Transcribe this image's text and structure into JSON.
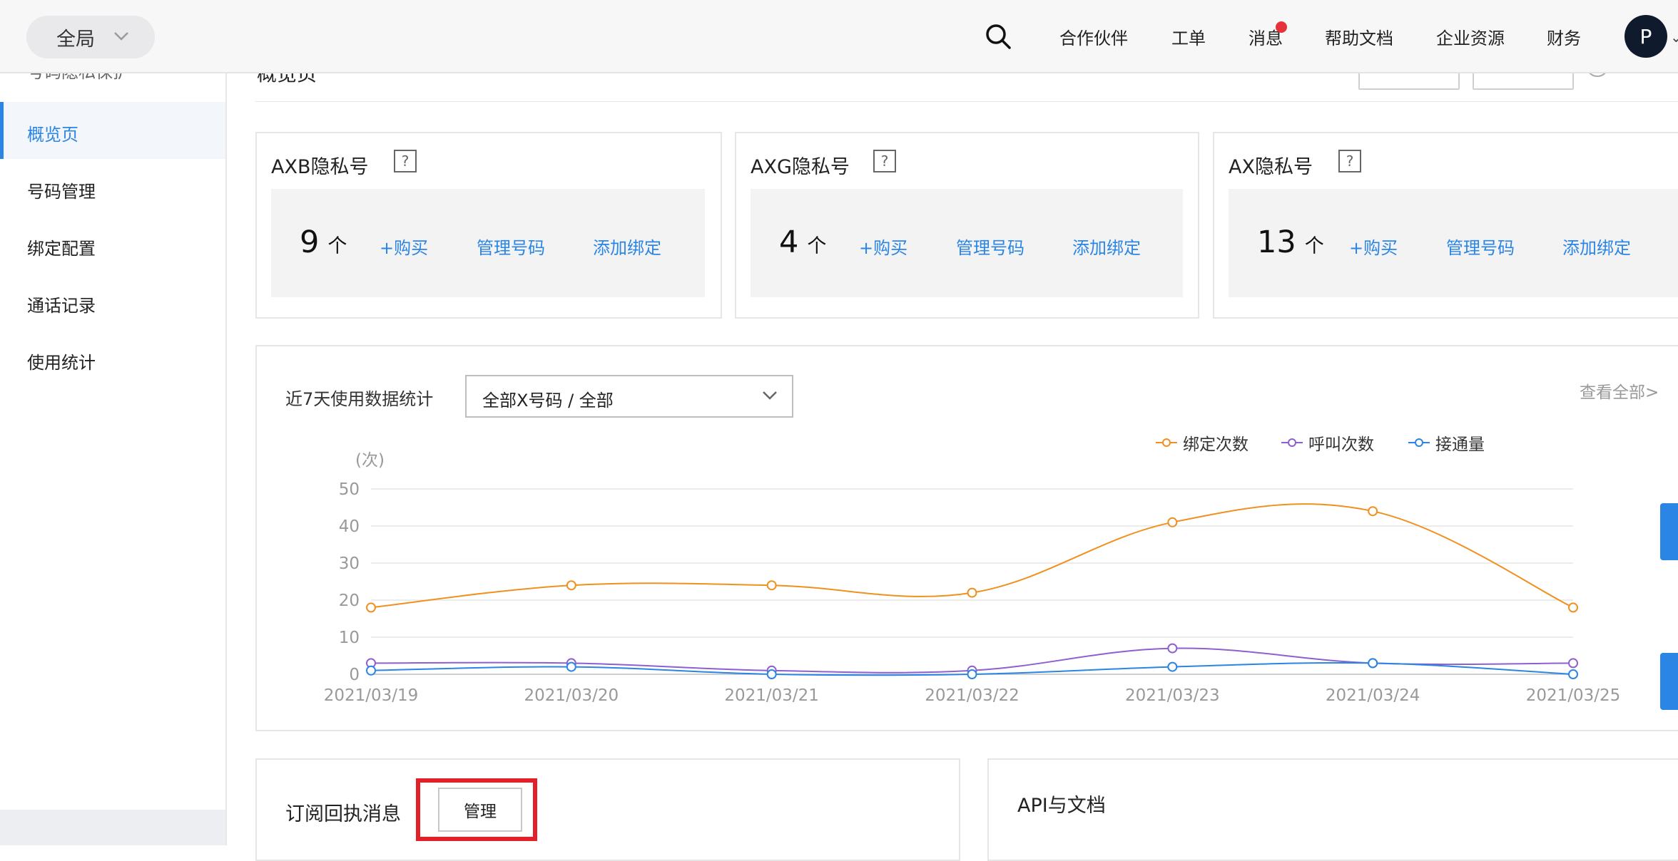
{
  "topbar": {
    "scope_label": "全局",
    "nav": [
      "合作伙伴",
      "工单",
      "消息",
      "帮助文档",
      "企业资源",
      "财务"
    ],
    "avatar_letter": "P"
  },
  "sidebar": {
    "cut_text": "号码隐私保护",
    "items": [
      "概览页",
      "号码管理",
      "绑定配置",
      "通话记录",
      "使用统计"
    ],
    "active_index": 0
  },
  "page": {
    "title_cut": "概览页"
  },
  "cards": [
    {
      "title": "AXB隐私号",
      "count": "9",
      "unit": "个",
      "buy": "+购买",
      "manage": "管理号码",
      "bind": "添加绑定"
    },
    {
      "title": "AXG隐私号",
      "count": "4",
      "unit": "个",
      "buy": "+购买",
      "manage": "管理号码",
      "bind": "添加绑定"
    },
    {
      "title": "AX隐私号",
      "count": "13",
      "unit": "个",
      "buy": "+购买",
      "manage": "管理号码",
      "bind": "添加绑定"
    }
  ],
  "help_glyph": "?",
  "stats": {
    "label": "近7天使用数据统计",
    "filter_value": "全部X号码 / 全部",
    "view_all": "查看全部>"
  },
  "chart_data": {
    "type": "line",
    "ylabel": "(次)",
    "ylim": [
      0,
      50
    ],
    "yticks": [
      0,
      10,
      20,
      30,
      40,
      50
    ],
    "grid": true,
    "legend_position": "top-right",
    "x": [
      "2021/03/19",
      "2021/03/20",
      "2021/03/21",
      "2021/03/22",
      "2021/03/23",
      "2021/03/24",
      "2021/03/25"
    ],
    "series": [
      {
        "name": "绑定次数",
        "color": "#f0901e",
        "values": [
          18,
          24,
          24,
          22,
          41,
          44,
          18
        ]
      },
      {
        "name": "呼叫次数",
        "color": "#8e5fd0",
        "values": [
          3,
          3,
          1,
          1,
          7,
          3,
          3
        ]
      },
      {
        "name": "接通量",
        "color": "#2b85e4",
        "values": [
          1,
          2,
          0,
          0,
          2,
          3,
          0
        ]
      }
    ]
  },
  "subscription": {
    "title": "订阅回执消息",
    "manage_label": "管理"
  },
  "api": {
    "title": "API与文档"
  },
  "colors": {
    "accent": "#2b85e4",
    "highlight": "#e3202a"
  }
}
